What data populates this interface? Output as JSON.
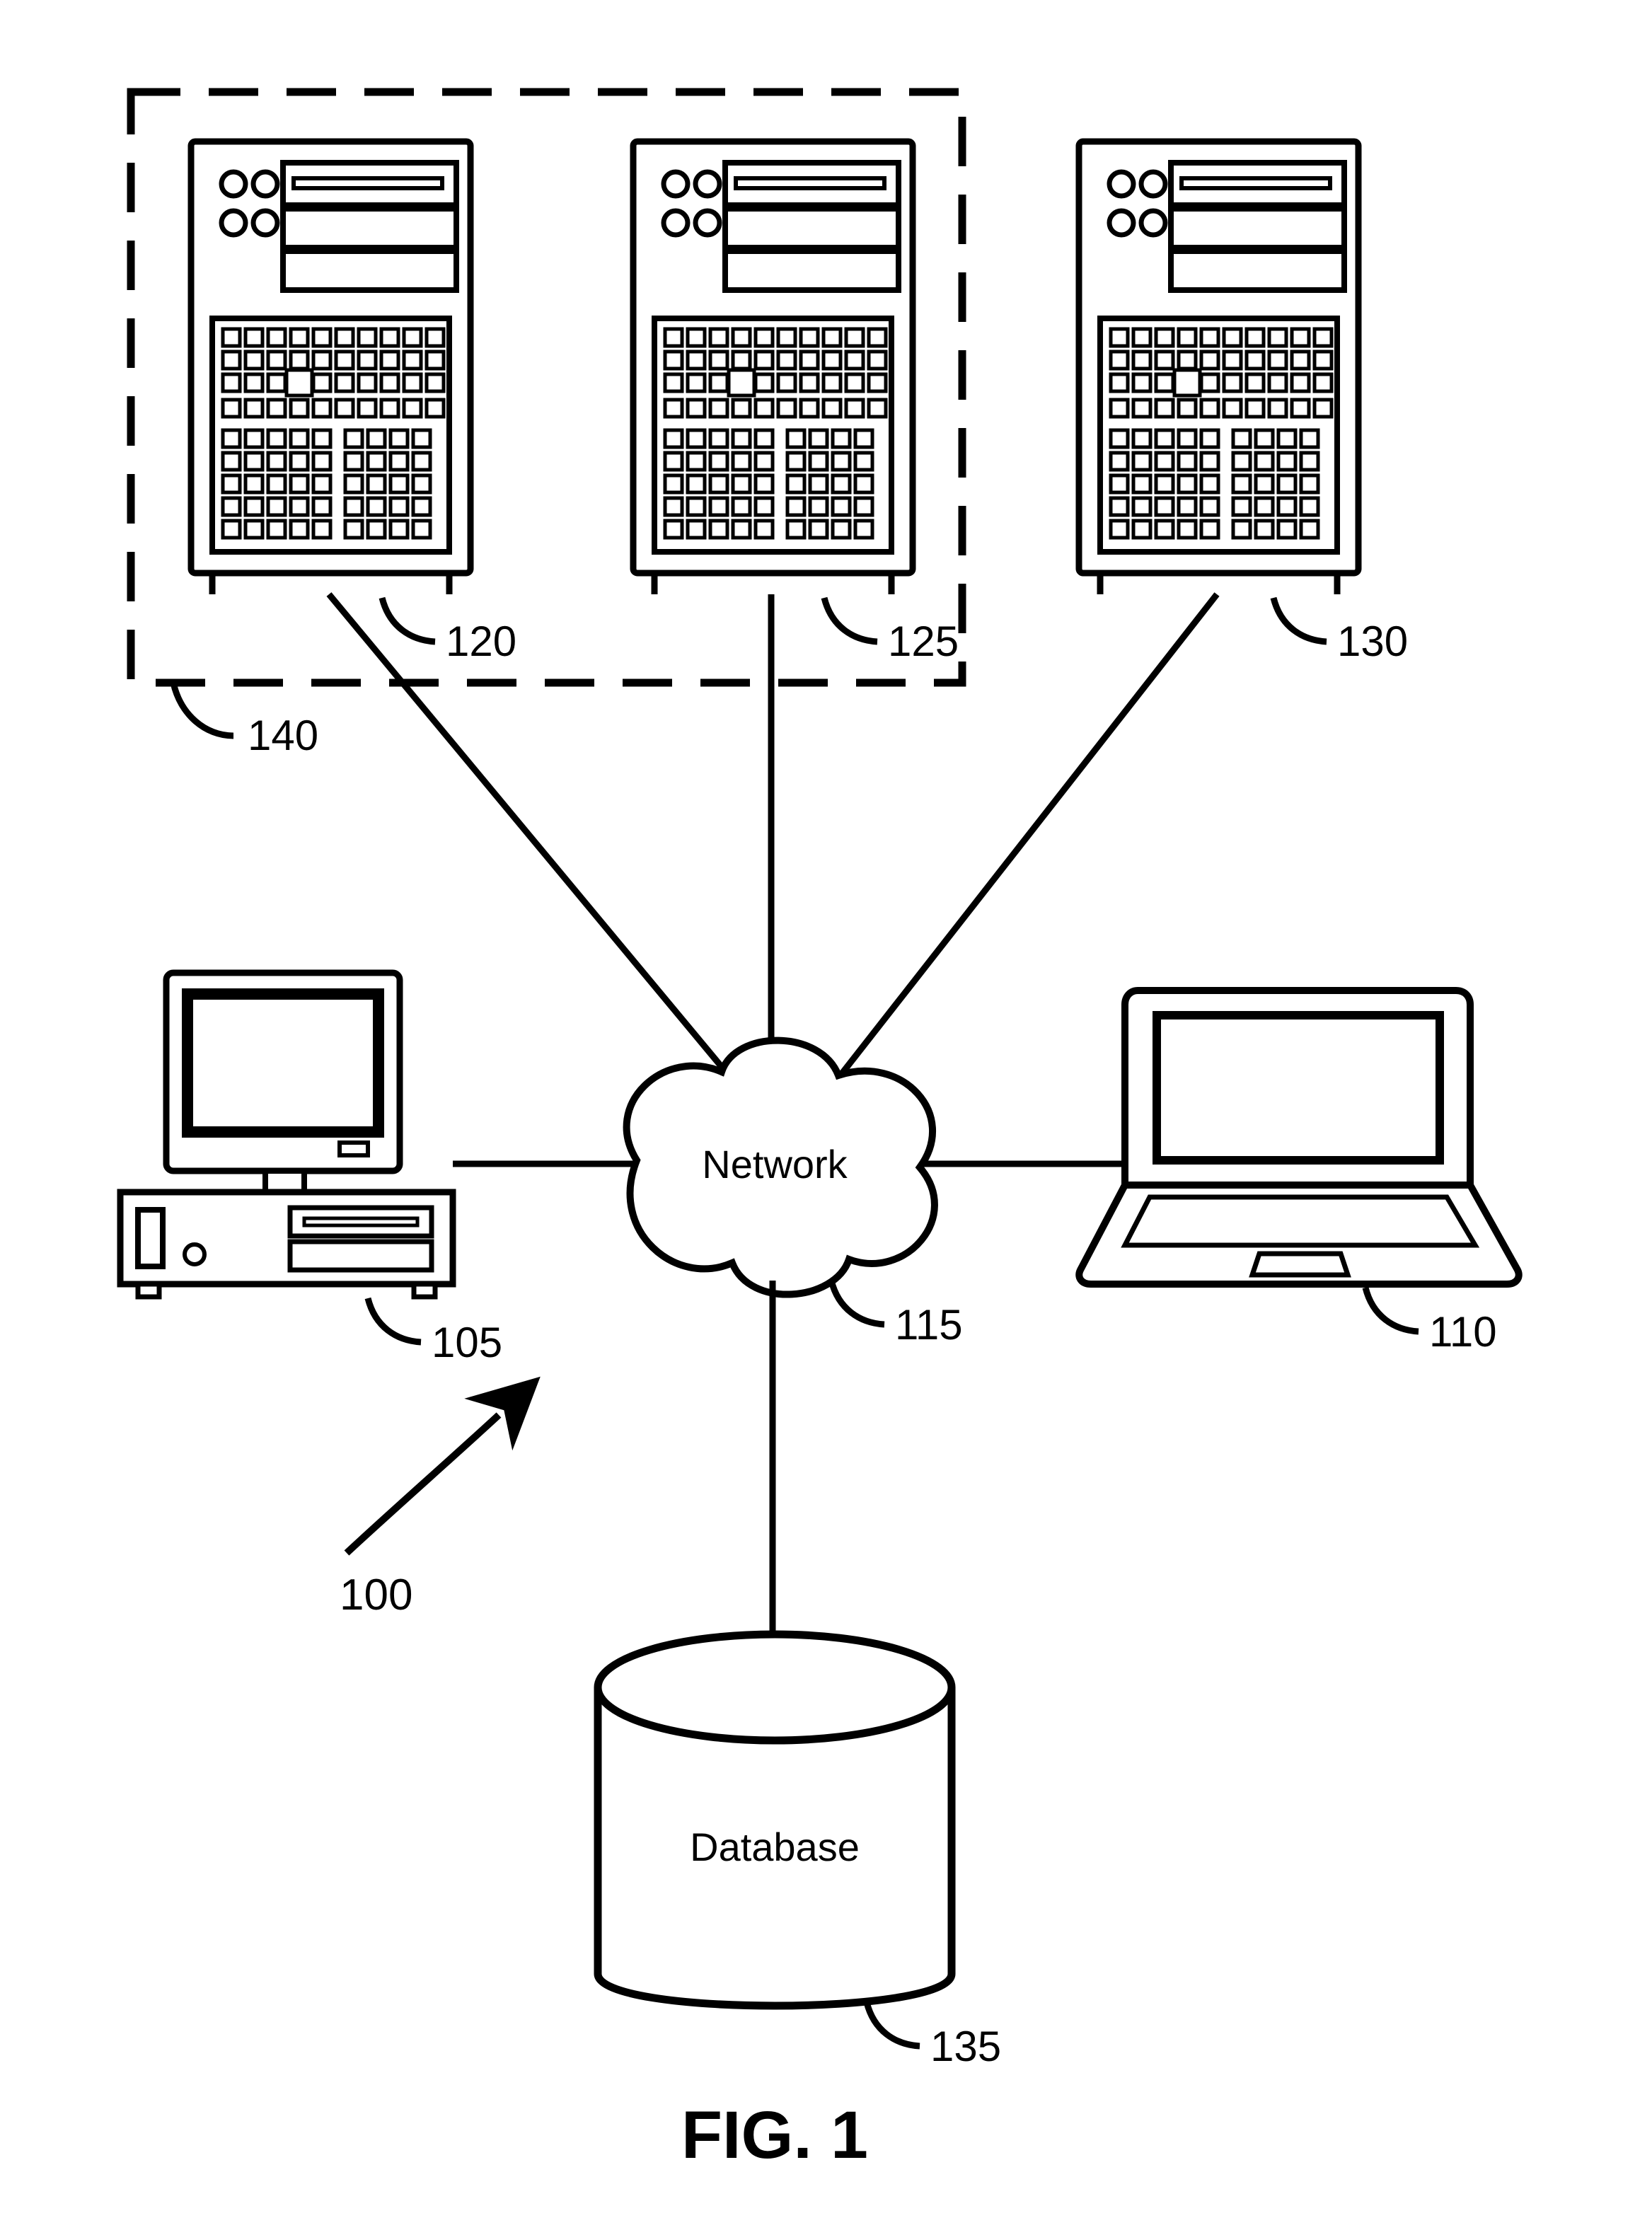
{
  "figure": {
    "caption": "FIG. 1",
    "system_ref": "100"
  },
  "nodes": {
    "network": {
      "label": "Network",
      "ref": "115"
    },
    "desktop": {
      "ref": "105"
    },
    "laptop": {
      "ref": "110"
    },
    "server_left": {
      "ref": "120"
    },
    "server_mid": {
      "ref": "125"
    },
    "server_right": {
      "ref": "130"
    },
    "server_group": {
      "ref": "140"
    },
    "database": {
      "label": "Database",
      "ref": "135"
    }
  },
  "edges": [
    [
      "server_left",
      "network"
    ],
    [
      "server_mid",
      "network"
    ],
    [
      "server_right",
      "network"
    ],
    [
      "desktop",
      "network"
    ],
    [
      "laptop",
      "network"
    ],
    [
      "database",
      "network"
    ]
  ]
}
